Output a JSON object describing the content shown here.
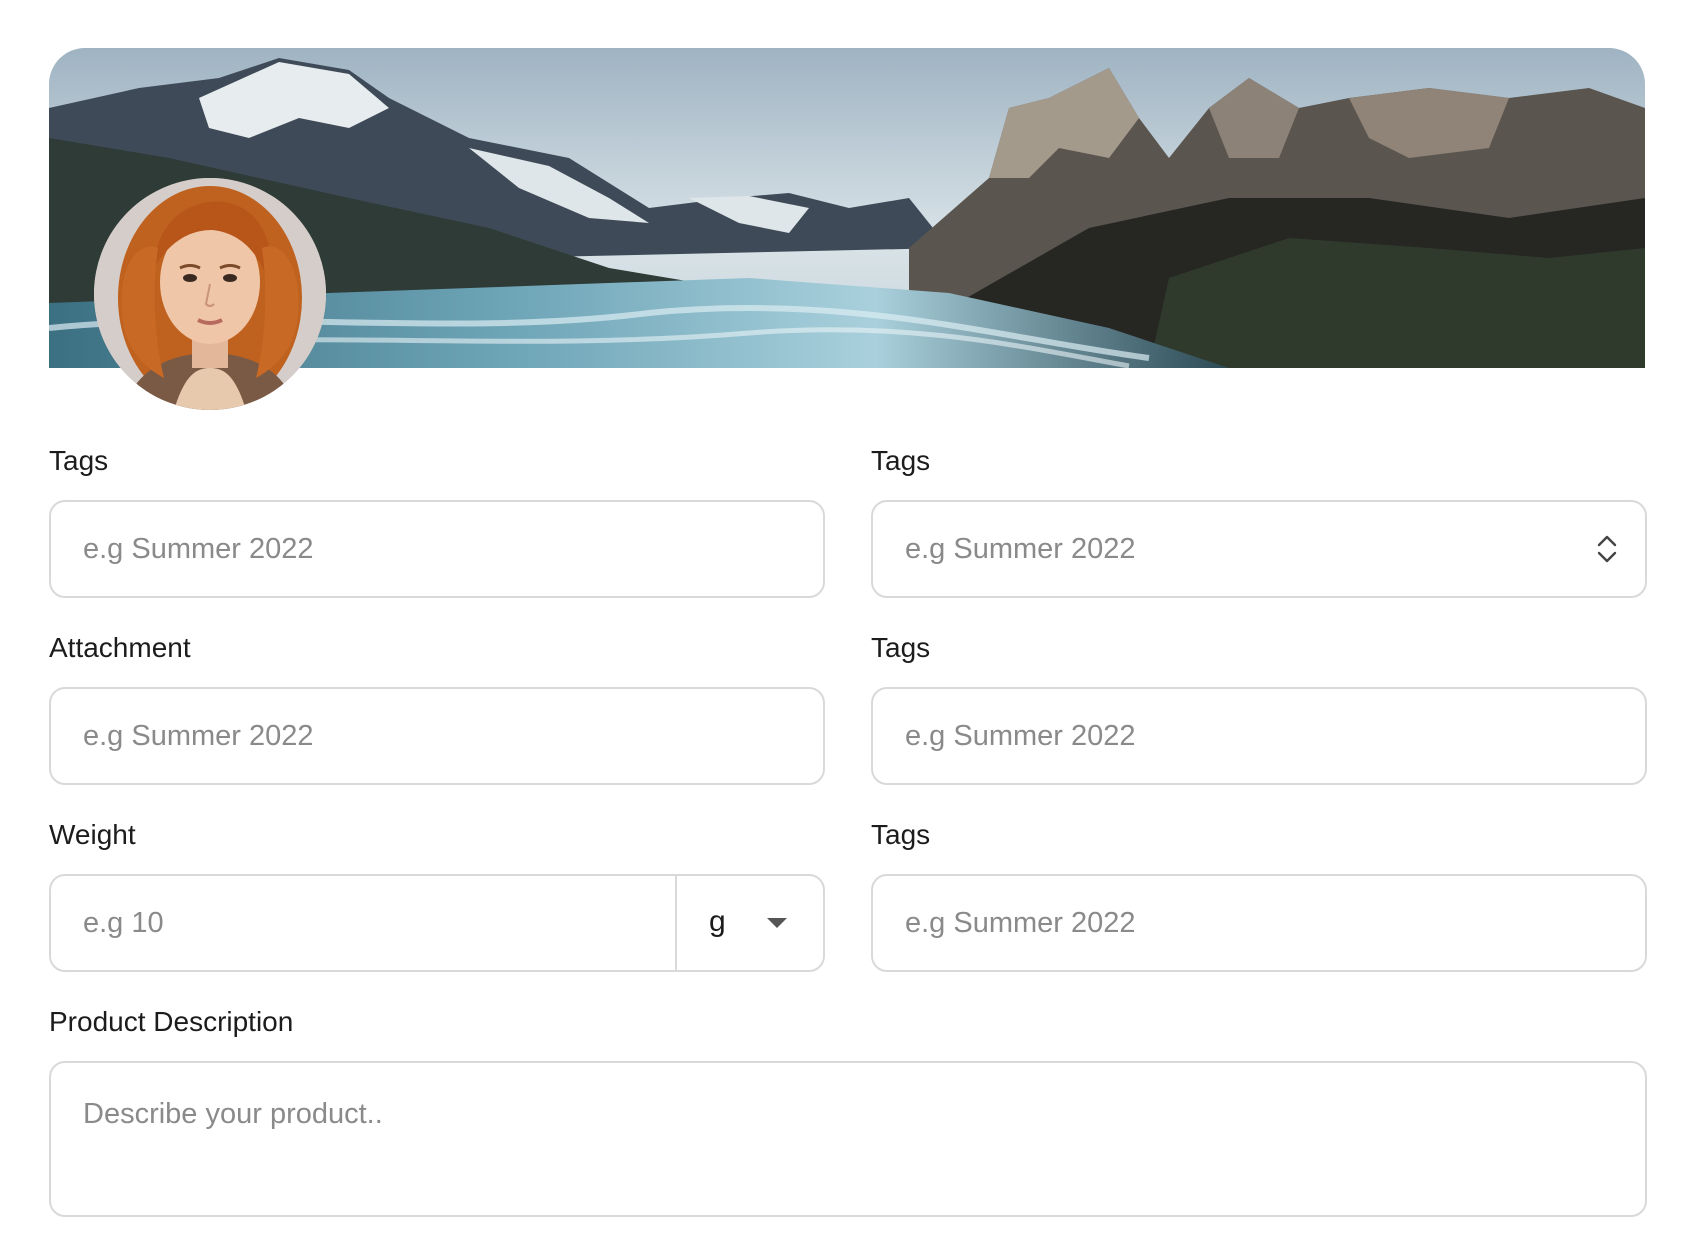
{
  "profile": {
    "cover_alt": "mountain-landscape",
    "avatar_alt": "user-avatar"
  },
  "form": {
    "tags_1": {
      "label": "Tags",
      "placeholder": "e.g Summer 2022"
    },
    "tags_2": {
      "label": "Tags",
      "placeholder": "e.g Summer 2022"
    },
    "attachment": {
      "label": "Attachment",
      "placeholder": "e.g Summer 2022"
    },
    "tags_3": {
      "label": "Tags",
      "placeholder": "e.g Summer 2022"
    },
    "weight": {
      "label": "Weight",
      "placeholder": "e.g 10",
      "unit": "g"
    },
    "tags_4": {
      "label": "Tags",
      "placeholder": "e.g Summer 2022"
    },
    "description": {
      "label": "Product Description",
      "placeholder": "Describe your product.."
    }
  },
  "colors": {
    "border": "#d9d9d9",
    "placeholder": "#8a8a8a",
    "text": "#1c1c1c"
  }
}
